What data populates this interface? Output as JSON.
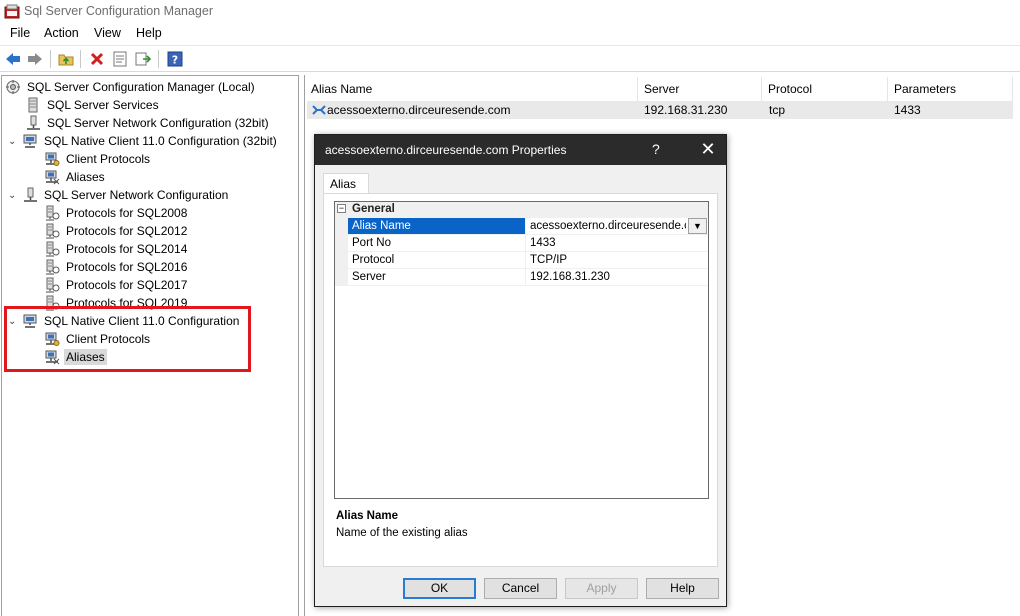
{
  "window": {
    "title": "Sql Server Configuration Manager"
  },
  "menu": [
    "File",
    "Action",
    "View",
    "Help"
  ],
  "toolbar": {
    "buttons": [
      "back-arrow-icon",
      "forward-arrow-icon",
      "up-folder-icon",
      "delete-icon",
      "properties-icon",
      "export-list-icon",
      "help-icon"
    ]
  },
  "tree": {
    "nodes": [
      {
        "label": "SQL Server Configuration Manager (Local)"
      },
      {
        "label": "SQL Server Services"
      },
      {
        "label": "SQL Server Network Configuration (32bit)"
      },
      {
        "label": "SQL Native Client 11.0 Configuration (32bit)"
      },
      {
        "label": "Client Protocols"
      },
      {
        "label": "Aliases"
      },
      {
        "label": "SQL Server Network Configuration"
      },
      {
        "label": "Protocols for SQL2008"
      },
      {
        "label": "Protocols for SQL2012"
      },
      {
        "label": "Protocols for SQL2014"
      },
      {
        "label": "Protocols for SQL2016"
      },
      {
        "label": "Protocols for SQL2017"
      },
      {
        "label": "Protocols for SQL2019"
      },
      {
        "label": "SQL Native Client 11.0 Configuration"
      },
      {
        "label": "Client Protocols"
      },
      {
        "label": "Aliases"
      }
    ]
  },
  "list": {
    "columns": [
      "Alias Name",
      "Server",
      "Protocol",
      "Parameters"
    ],
    "rows": [
      {
        "alias": "acessoexterno.dirceuresende.com",
        "server": "192.168.31.230",
        "protocol": "tcp",
        "parameters": "1433"
      }
    ]
  },
  "dialog": {
    "title": "acessoexterno.dirceuresende.com Properties",
    "help_glyph": "?",
    "close_glyph": "✕",
    "tab": "Alias",
    "category": "General",
    "collapse_glyph": "−",
    "properties": [
      {
        "name": "Alias Name",
        "value": "acessoexterno.dirceuresende.com"
      },
      {
        "name": "Port No",
        "value": "1433"
      },
      {
        "name": "Protocol",
        "value": "TCP/IP"
      },
      {
        "name": "Server",
        "value": "192.168.31.230"
      }
    ],
    "description_title": "Alias Name",
    "description_text": "Name of the existing alias",
    "buttons": {
      "ok": "OK",
      "cancel": "Cancel",
      "apply": "Apply",
      "help": "Help"
    }
  },
  "colors": {
    "highlight_box": "#e0181e",
    "selection": "#0a64c8",
    "dialog_titlebar": "#2b2b2b"
  }
}
